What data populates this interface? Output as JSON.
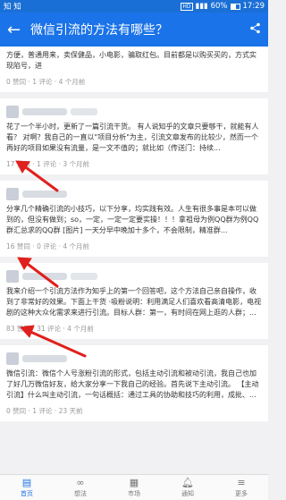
{
  "status": {
    "left": "知 知",
    "hd": "HD",
    "battery": "60%",
    "time": "17:29"
  },
  "appbar": {
    "title": "微信引流的方法有哪些？",
    "back": "←",
    "share": "<"
  },
  "cards": [
    {
      "text": "方便，普通用来，卖保健品，小电影，骗取红包。目前都是以购买买的，方式实现陷号，进",
      "meta": "0 赞同 · 1 评论 · 4 个月前"
    },
    {
      "text": "花了一个半小时，更新了一篇引流干货。 有人说知乎的文章只要够干，就能有人看？ 对啊？我自己的一直以\"项目分析\"为主，引流文章发布的比较少，然而一个再好的项目如果没有流量，是一文不值的；就比如（传送门：持续...",
      "meta": "17 赞同 · 1 评论 · 3 个月前"
    },
    {
      "text": "分享几个精确引流的小技巧，以下分享，均实践有效。人生有很多事是本可以做到的，但没有做到；so，一定，一定一定要实操！！！拿祖母为例QQ群为例QQ群汇总求的QQ群 [图片] 一天分早中晚加十多个，不会限制，精准群...",
      "meta": "16 赞同 · 0 评论 · 4 个月前"
    },
    {
      "text": "我来介绍一个引流方法作为知乎上的第一个回答吧，这个方法自己亲自操作，收到了非常好的效果。下面上干货 ·吸粉说明：利用满足人们喜欢看高清电影，电视剧的这种大众化需求来进行引流。目标人群：第一，有时间在网上逛的人群；...",
      "meta": "83 赞同 · 31 评论 · 4 个月前"
    },
    {
      "text": "微信引流：微信个人号涨粉引流的形式，包括主动引流和被动引流，我自己也加了好几万微信好友，给大家分享一下我自己的经验。首先说下主动引流。 【主动引流】什么叫主动引流，一句话概括：通过工具的协助和技巧的利用，成批、...",
      "meta": "0 赞同 · 1 评论 · 23 天前"
    }
  ],
  "nav": [
    {
      "label": "首页",
      "icon": "home-icon"
    },
    {
      "label": "想法",
      "icon": "idea-icon"
    },
    {
      "label": "市场",
      "icon": "market-icon"
    },
    {
      "label": "通知",
      "icon": "bell-icon"
    },
    {
      "label": "更多",
      "icon": "menu-icon"
    }
  ],
  "colors": {
    "accent": "#1a73e8",
    "arrow": "#e0201c"
  }
}
